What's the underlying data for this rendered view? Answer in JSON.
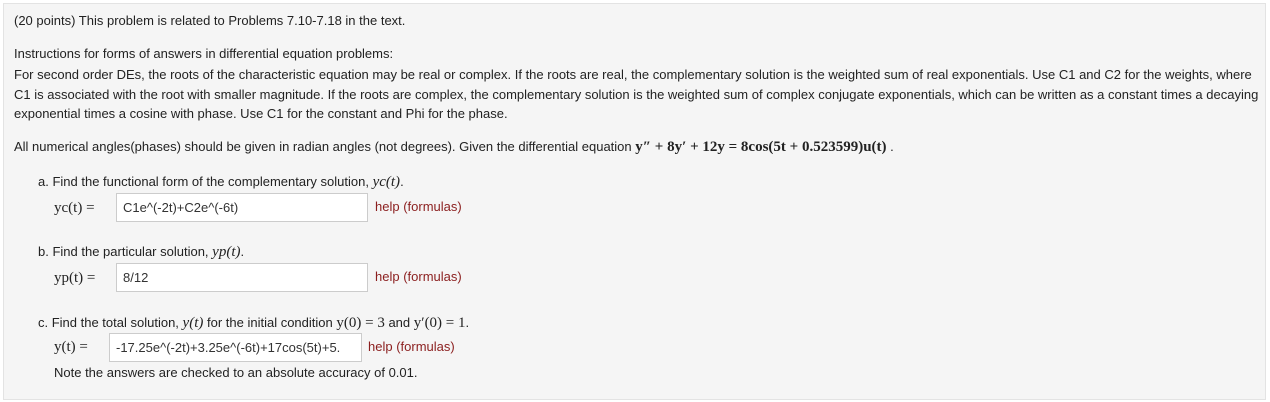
{
  "header": "(20 points) This problem is related to Problems 7.10-7.18 in the text.",
  "instructions_title": "Instructions for forms of answers in differential equation problems:",
  "instructions_body": "For second order DEs, the roots of the characteristic equation may be real or complex. If the roots are real, the complementary solution is the weighted sum of real exponentials. Use C1 and C2 for the weights, where C1 is associated with the root with smaller magnitude. If the roots are complex, the complementary solution is the weighted sum of complex conjugate exponentials, which can be written as a constant times a decaying exponential times a cosine with phase. Use C1 for the constant and Phi for the phase.",
  "angles_note": "All numerical angles(phases) should be given in radian angles (not degrees). Given the differential equation",
  "equation": "y″ + 8y′ + 12y = 8cos(5t + 0.523599)u(t)",
  "part_a": {
    "prompt": "a. Find the functional form of the complementary solution,",
    "symbol": "yc(t)",
    "label": "yc(t) =",
    "value": "C1e^(-2t)+C2e^(-6t)",
    "help": "help (formulas)"
  },
  "part_b": {
    "prompt": "b. Find the particular solution,",
    "symbol": "yp(t)",
    "label": "yp(t) =",
    "value": "8/12",
    "help": "help (formulas)"
  },
  "part_c": {
    "prompt": "c. Find the total solution,",
    "prompt_mid": "for the initial condition",
    "symbol": "y(t)",
    "ic1": "y(0) = 3",
    "ic_and": "and",
    "ic2": "y′(0) = 1",
    "label": "y(t) =",
    "value": "-17.25e^(-2t)+3.25e^(-6t)+17cos(5t)+5.",
    "help": "help (formulas)"
  },
  "accuracy_note": "Note the answers are checked to an absolute accuracy of 0.01."
}
